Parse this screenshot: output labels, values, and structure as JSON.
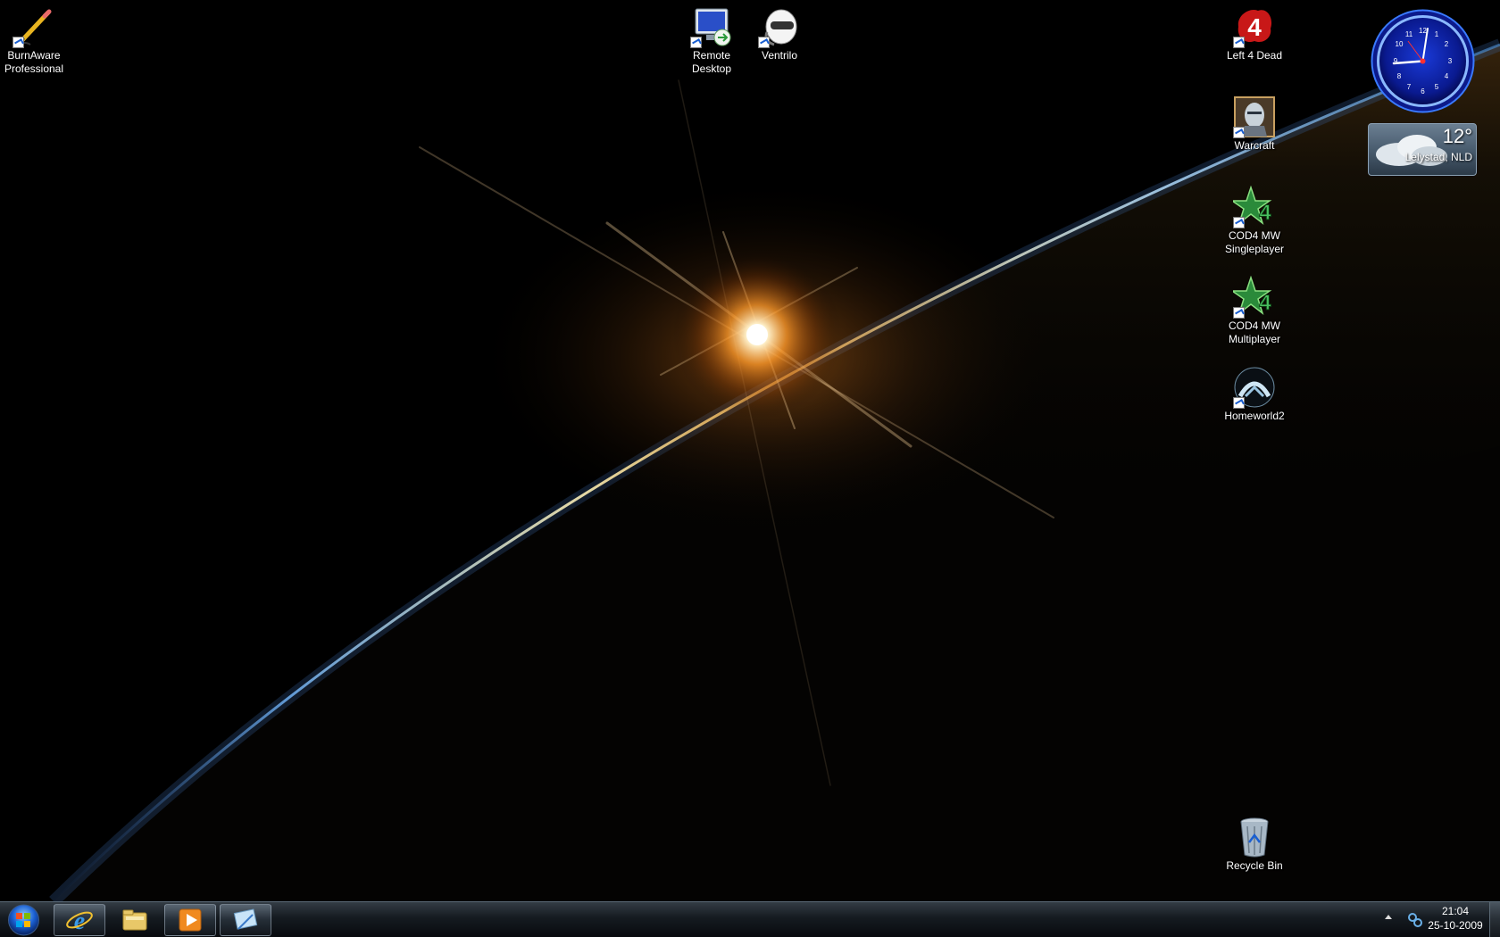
{
  "desktop": {
    "icons": {
      "burnaware": "BurnAware\nProfessional",
      "remote_desktop": "Remote\nDesktop",
      "ventrilo": "Ventrilo",
      "left4dead": "Left 4 Dead",
      "warcraft": "Warcraft",
      "cod4_sp": "COD4 MW\nSingleplayer",
      "cod4_mp": "COD4 MW\nMultiplayer",
      "homeworld2": "Homeworld2",
      "recycle_bin": "Recycle Bin"
    }
  },
  "gadgets": {
    "clock": {
      "time": "21:04"
    },
    "weather": {
      "temperature": "12°",
      "location": "Lelystad, NLD"
    }
  },
  "taskbar": {
    "buttons": [
      "start-orb-icon",
      "internet-explorer-icon",
      "windows-explorer-icon",
      "media-player-icon",
      "snipping-tool-icon"
    ],
    "time": "21:04",
    "date": "25-10-2009"
  },
  "colors": {
    "accent": "#1a5fd1",
    "planet_glow": "#ff9a2a"
  }
}
